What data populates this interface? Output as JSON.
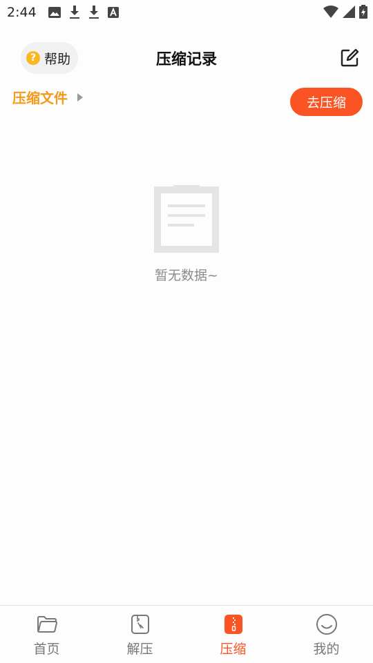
{
  "status_bar": {
    "time": "2:44",
    "left_icons": [
      "image-icon",
      "download-icon",
      "download-icon",
      "text-icon"
    ],
    "right_icons": [
      "wifi-icon",
      "signal-icon",
      "battery-icon"
    ]
  },
  "header": {
    "help_label": "帮助",
    "help_icon_text": "?",
    "title": "压缩记录"
  },
  "breadcrumb": {
    "label": "压缩文件"
  },
  "actions": {
    "go_compress_label": "去压缩"
  },
  "empty_state": {
    "text": "暂无数据~"
  },
  "bottom_nav": {
    "items": [
      {
        "label": "首页",
        "icon": "folder-icon"
      },
      {
        "label": "解压",
        "icon": "unzip-icon"
      },
      {
        "label": "压缩",
        "icon": "zip-icon",
        "active": true
      },
      {
        "label": "我的",
        "icon": "smile-icon"
      }
    ]
  },
  "colors": {
    "accent": "#fb5424",
    "breadcrumb": "#f39a1a",
    "help_icon": "#f8b823"
  }
}
